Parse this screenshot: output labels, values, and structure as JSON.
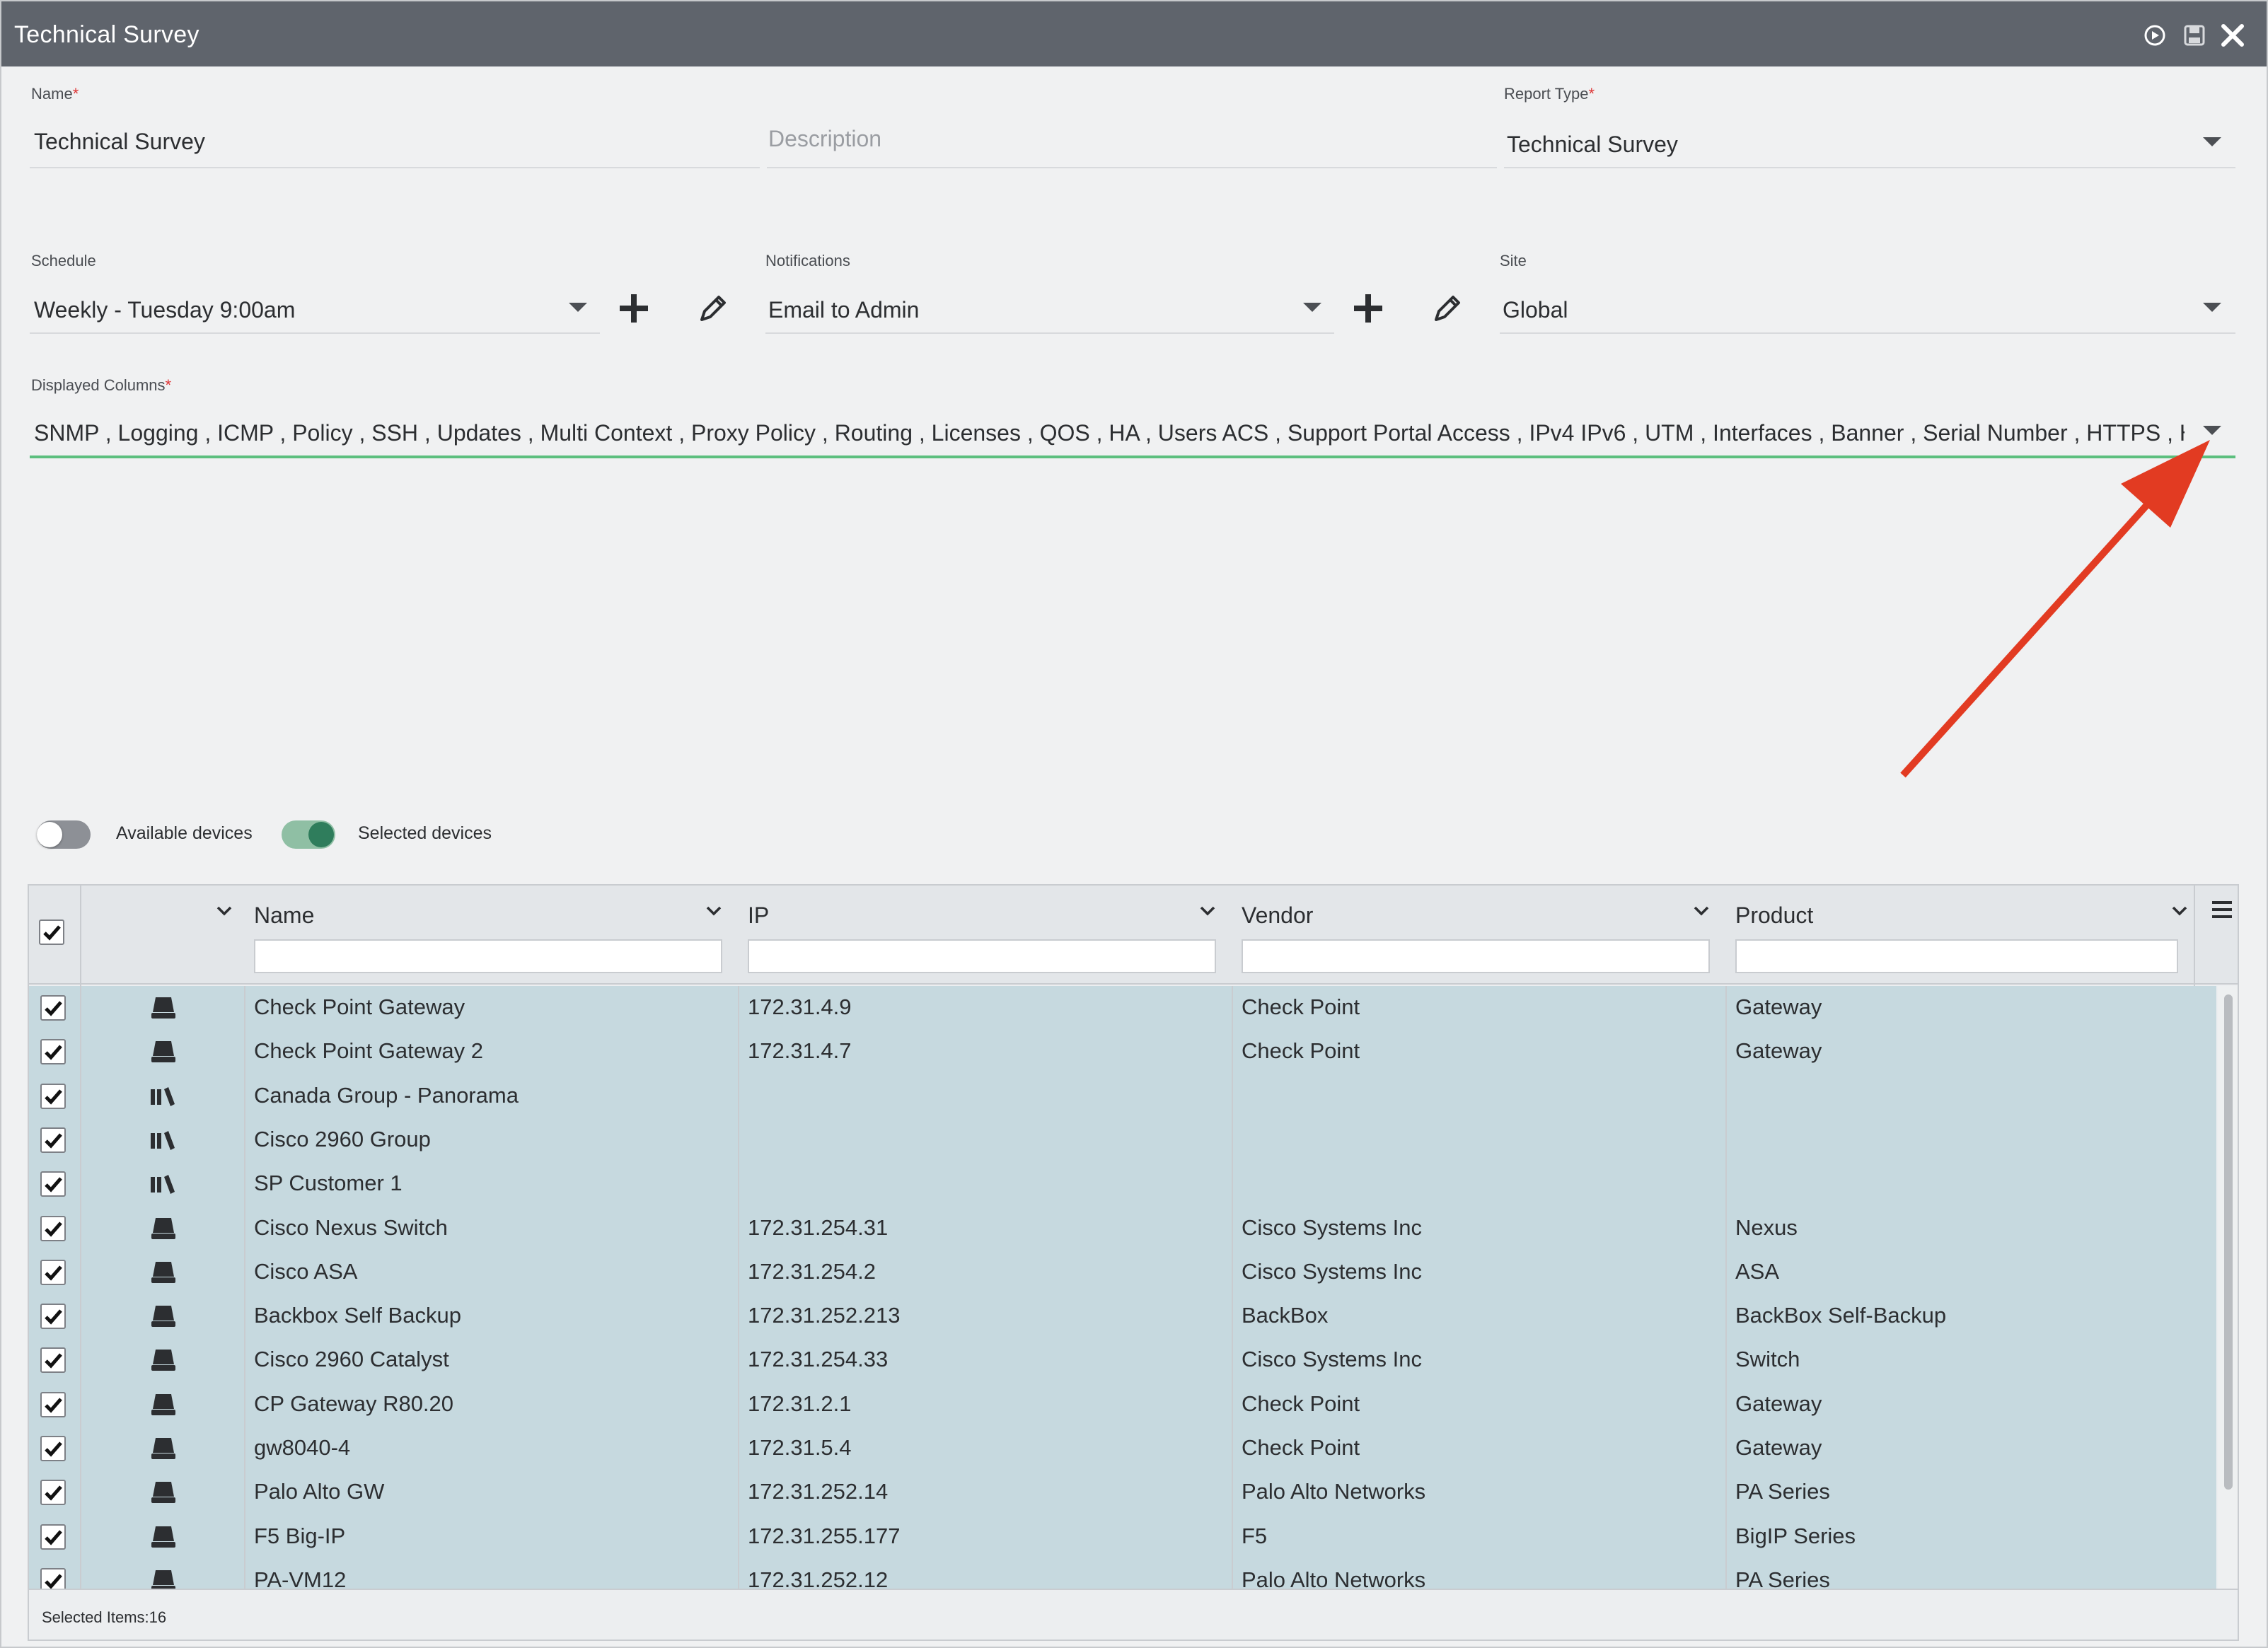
{
  "window": {
    "title": "Technical Survey",
    "controls": {
      "run": "play-circle-icon",
      "save": "save-icon",
      "close": "close-icon"
    }
  },
  "form": {
    "name": {
      "label": "Name",
      "required_mark": "*",
      "value": "Technical Survey"
    },
    "description": {
      "placeholder": "Description"
    },
    "report_type": {
      "label": "Report Type",
      "required_mark": "*",
      "value": "Technical Survey"
    },
    "schedule": {
      "label": "Schedule",
      "value": "Weekly - Tuesday 9:00am"
    },
    "notifications": {
      "label": "Notifications",
      "value": "Email to Admin"
    },
    "site": {
      "label": "Site",
      "value": "Global"
    },
    "displayed_columns": {
      "label": "Displayed Columns",
      "required_mark": "*",
      "value": "SNMP , Logging , ICMP , Policy , SSH , Updates , Multi Context , Proxy Policy , Routing , Licenses , QOS , HA , Users ACS , Support Portal Access , IPv4 IPv6 , UTM , Interfaces , Banner , Serial Number , HTTPS , Hostn..."
    }
  },
  "toggles": {
    "available": {
      "label": "Available devices",
      "on": false
    },
    "selected": {
      "label": "Selected devices",
      "on": true
    }
  },
  "grid": {
    "columns": [
      "Name",
      "IP",
      "Vendor",
      "Product"
    ],
    "rows": [
      {
        "type": "device",
        "name": "Check Point Gateway",
        "ip": "172.31.4.9",
        "vendor": "Check Point",
        "product": "Gateway"
      },
      {
        "type": "device",
        "name": "Check Point Gateway 2",
        "ip": "172.31.4.7",
        "vendor": "Check Point",
        "product": "Gateway"
      },
      {
        "type": "group",
        "name": "Canada Group - Panorama",
        "ip": "",
        "vendor": "",
        "product": ""
      },
      {
        "type": "group",
        "name": "Cisco 2960 Group",
        "ip": "",
        "vendor": "",
        "product": ""
      },
      {
        "type": "group",
        "name": "SP Customer 1",
        "ip": "",
        "vendor": "",
        "product": ""
      },
      {
        "type": "device",
        "name": "Cisco Nexus Switch",
        "ip": "172.31.254.31",
        "vendor": "Cisco Systems Inc",
        "product": "Nexus"
      },
      {
        "type": "device",
        "name": "Cisco ASA",
        "ip": "172.31.254.2",
        "vendor": "Cisco Systems Inc",
        "product": "ASA"
      },
      {
        "type": "device",
        "name": "Backbox Self Backup",
        "ip": "172.31.252.213",
        "vendor": "BackBox",
        "product": "BackBox Self-Backup"
      },
      {
        "type": "device",
        "name": "Cisco 2960 Catalyst",
        "ip": "172.31.254.33",
        "vendor": "Cisco Systems Inc",
        "product": "Switch"
      },
      {
        "type": "device",
        "name": "CP Gateway R80.20",
        "ip": "172.31.2.1",
        "vendor": "Check Point",
        "product": "Gateway"
      },
      {
        "type": "device",
        "name": "gw8040-4",
        "ip": "172.31.5.4",
        "vendor": "Check Point",
        "product": "Gateway"
      },
      {
        "type": "device",
        "name": "Palo Alto GW",
        "ip": "172.31.252.14",
        "vendor": "Palo Alto Networks",
        "product": "PA Series"
      },
      {
        "type": "device",
        "name": "F5 Big-IP",
        "ip": "172.31.255.177",
        "vendor": "F5",
        "product": "BigIP Series"
      },
      {
        "type": "device",
        "name": "PA-VM12",
        "ip": "172.31.252.12",
        "vendor": "Palo Alto Networks",
        "product": "PA Series"
      }
    ],
    "footer": "Selected Items:16"
  },
  "colors": {
    "titlebar": "#5f646c",
    "accent_green": "#5cbf7e",
    "row_selected": "#c6d9df",
    "annotation_arrow": "#e23b22"
  }
}
